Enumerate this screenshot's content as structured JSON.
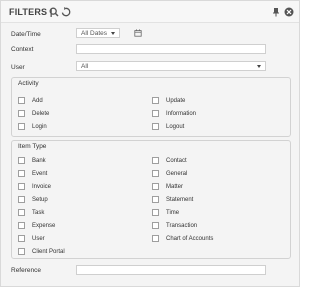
{
  "header": {
    "title": "FILTERS |",
    "icons": [
      "search-icon",
      "reset-icon",
      "pin-icon",
      "close-icon"
    ]
  },
  "fields": {
    "datetime": {
      "label": "Date/Time",
      "value": "All Dates"
    },
    "context": {
      "label": "Context",
      "value": ""
    },
    "user": {
      "label": "User",
      "value": "All"
    },
    "reference": {
      "label": "Reference",
      "value": ""
    }
  },
  "activity": {
    "title": "Activity",
    "items": [
      "Add",
      "Update",
      "Delete",
      "Information",
      "Login",
      "Logout"
    ]
  },
  "item_type": {
    "title": "Item Type",
    "items": [
      "Bank",
      "Contact",
      "Event",
      "General",
      "Invoice",
      "Matter",
      "Setup",
      "Statement",
      "Task",
      "Time",
      "Expense",
      "Transaction",
      "User",
      "Chart of Accounts",
      "Client Portal"
    ]
  },
  "colors": {
    "border": "#d2d2d2",
    "background": "#f4f4f4",
    "input_bg": "#ffffff",
    "text": "#333333"
  }
}
